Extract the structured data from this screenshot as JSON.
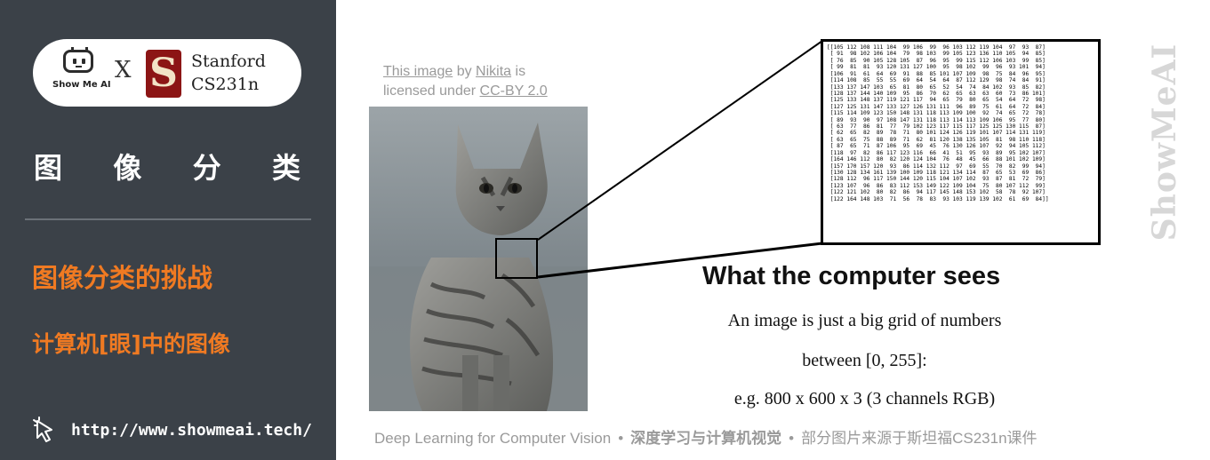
{
  "brand": {
    "showmeai_label": "Show Me AI",
    "times": "X",
    "stanford_letter": "S",
    "stanford_line1": "Stanford",
    "stanford_line2": "CS231n",
    "vertical_brand": "ShowMeAI"
  },
  "sidebar": {
    "category_chars": [
      "图",
      "像",
      "分",
      "类"
    ],
    "heading": "图像分类的挑战",
    "subheading": "计算机[眼]中的图像",
    "url": "http://www.showmeai.tech/"
  },
  "slide": {
    "attribution": {
      "image_link": "This image",
      "by": " by ",
      "author": "Nikita",
      "is": " is",
      "licensed": "licensed under ",
      "license": "CC-BY 2.0"
    },
    "title": "What the computer sees",
    "desc_line1": "An image is just a big grid of numbers",
    "desc_line2": "between [0, 255]:",
    "desc_line3": "e.g. 800 x 600 x 3 (3 channels RGB)",
    "matrix_rows": [
      "[[105 112 108 111 104  99 106  99  96 103 112 119 104  97  93  87]",
      " [ 91  98 102 106 104  79  98 103  99 105 123 136 110 105  94  85]",
      " [ 76  85  90 105 128 105  87  96  95  99 115 112 106 103  99  85]",
      " [ 99  81  81  93 120 131 127 100  95  98 102  99  96  93 101  94]",
      " [106  91  61  64  69  91  88  85 101 107 109  98  75  84  96  95]",
      " [114 108  85  55  55  69  64  54  64  87 112 129  98  74  84  91]",
      " [133 137 147 103  65  81  80  65  52  54  74  84 102  93  85  82]",
      " [128 137 144 140 109  95  86  70  62  65  63  63  60  73  86 101]",
      " [125 133 148 137 119 121 117  94  65  79  80  65  54  64  72  98]",
      " [127 125 131 147 133 127 126 131 111  96  89  75  61  64  72  84]",
      " [115 114 109 123 150 148 131 118 113 109 100  92  74  65  72  78]",
      " [ 89  93  90  97 108 147 131 118 113 114 113 109 106  95  77  80]",
      " [ 63  77  86  81  77  79 102 123 117 115 117 125 125 130 115  87]",
      " [ 62  65  82  89  78  71  80 101 124 126 119 101 107 114 131 119]",
      " [ 63  65  75  88  89  71  62  81 120 138 135 105  81  98 110 118]",
      " [ 87  65  71  87 106  95  69  45  76 130 126 107  92  94 105 112]",
      " [118  97  82  86 117 123 116  66  41  51  95  93  89  95 102 107]",
      " [164 146 112  80  82 120 124 104  76  48  45  66  88 101 102 109]",
      " [157 170 157 120  93  86 114 132 112  97  69  55  70  82  99  94]",
      " [130 128 134 161 139 100 109 118 121 134 114  87  65  53  69  86]",
      " [128 112  96 117 150 144 120 115 104 107 102  93  87  81  72  79]",
      " [123 107  96  86  83 112 153 149 122 109 104  75  80 107 112  99]",
      " [122 121 102  80  82  86  94 117 145 148 153 102  58  78  92 107]",
      " [122 164 148 103  71  56  78  83  93 103 119 139 102  61  69  84]]"
    ]
  },
  "footer": {
    "course": "Deep Learning for Computer Vision",
    "sep1": "•",
    "cn_title": "深度学习与计算机视觉",
    "sep2": "•",
    "source": "部分图片来源于斯坦福CS231n课件"
  },
  "colors": {
    "sidebar_bg": "#3b4148",
    "accent_orange": "#f07a22",
    "stanford_red": "#8c1515"
  }
}
